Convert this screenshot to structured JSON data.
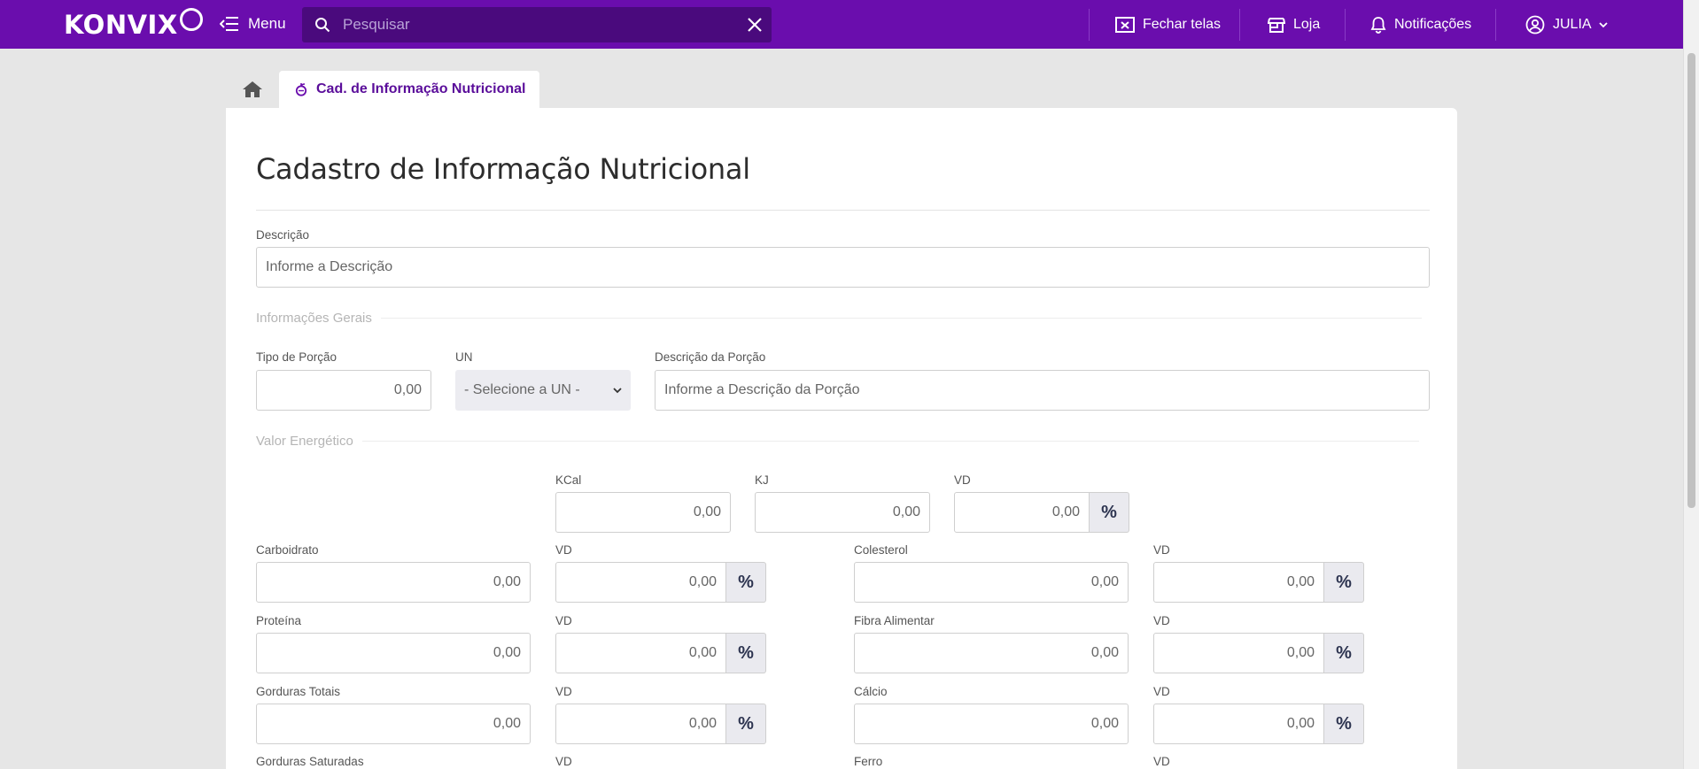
{
  "topbar": {
    "brand": "KONVIX",
    "menu_label": "Menu",
    "search_placeholder": "Pesquisar",
    "close_screens_label": "Fechar telas",
    "store_label": "Loja",
    "notifications_label": "Notificações",
    "user_label": "JULIA"
  },
  "tabs": {
    "active_label": "Cad. de Informação Nutricional"
  },
  "form": {
    "title": "Cadastro de Informação Nutricional",
    "descricao_label": "Descrição",
    "descricao_placeholder": "Informe a Descrição",
    "section_geral": "Informações Gerais",
    "tipo_porcao_label": "Tipo de Porção",
    "tipo_porcao_value": "0,00",
    "un_label": "UN",
    "un_selected": "- Selecione a UN -",
    "desc_porcao_label": "Descrição da Porção",
    "desc_porcao_placeholder": "Informe a Descrição da Porção",
    "section_energetico": "Valor Energético",
    "kcal_label": "KCal",
    "kcal_value": "0,00",
    "kj_label": "KJ",
    "kj_value": "0,00",
    "vd_label": "VD",
    "vd_value": "0,00",
    "pct_symbol": "%",
    "rows_left": [
      {
        "label": "Carboidrato",
        "value": "0,00",
        "vd_label": "VD",
        "vd_value": "0,00"
      },
      {
        "label": "Proteína",
        "value": "0,00",
        "vd_label": "VD",
        "vd_value": "0,00"
      },
      {
        "label": "Gorduras Totais",
        "value": "0,00",
        "vd_label": "VD",
        "vd_value": "0,00"
      },
      {
        "label": "Gorduras Saturadas",
        "vd_label": "VD"
      }
    ],
    "rows_right": [
      {
        "label": "Colesterol",
        "value": "0,00",
        "vd_label": "VD",
        "vd_value": "0,00"
      },
      {
        "label": "Fibra Alimentar",
        "value": "0,00",
        "vd_label": "VD",
        "vd_value": "0,00"
      },
      {
        "label": "Cálcio",
        "value": "0,00",
        "vd_label": "VD",
        "vd_value": "0,00"
      },
      {
        "label": "Ferro",
        "vd_label": "VD"
      }
    ]
  }
}
